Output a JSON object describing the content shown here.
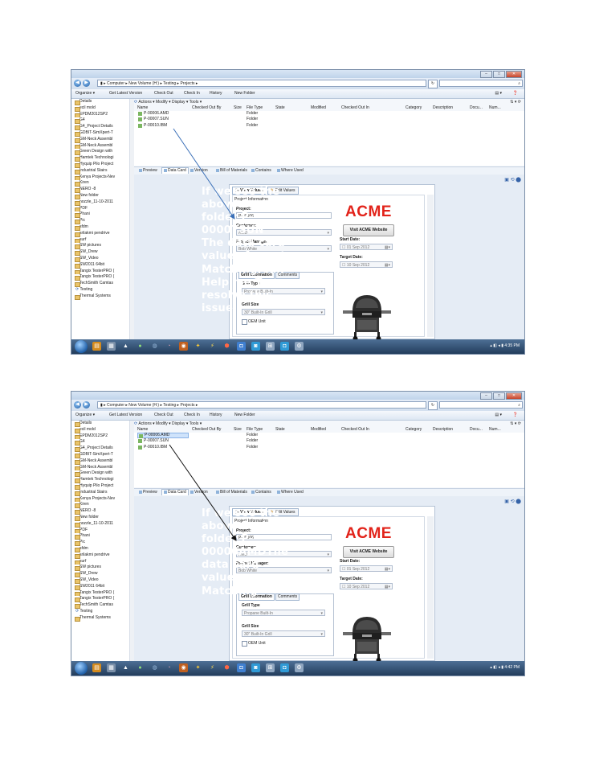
{
  "screenshots": [
    {
      "window": {
        "address": [
          "Computer",
          "New Volume (H:)",
          "Testing",
          "Projects"
        ],
        "menu": [
          "Organize ▾",
          "Get Latest Version",
          "Check Out",
          "Check In",
          "History",
          "New Folder"
        ]
      },
      "tree_items": [
        "Details",
        "ecil mold",
        "EPDM2012SP2",
        "G4",
        "G4_Project Details",
        "GDBIT-SimXpert-T",
        "GM-Neck Assembl",
        "GM-Neck Assembl",
        "Green Design with",
        "Hamtek Technologi",
        "Hyquip Pilo Project",
        "Industrial Stairs",
        "Kenya Projects-Nev",
        "Kiren",
        "NERO -8",
        "New folder",
        "nozzle_11-10-2011",
        "PDF",
        "Phani",
        "Pic",
        "sfdm",
        "srilakmi pendrive",
        "surf",
        "SW pictures",
        "SW_Drew",
        "SW_Video",
        "SW2011 64bit",
        "Tangix TesterPRO (",
        "Tangix TesterPRO (",
        "TechSmith Camtas"
      ],
      "vault_items": [
        "Testing",
        "Thermal Systems"
      ],
      "toolbar": {
        "actions": "Actions ▾",
        "modify": "Modify ▾",
        "display": "Display ▾",
        "tools": "Tools ▾"
      },
      "columns": [
        "Name",
        "Checked Out By",
        "Size",
        "File Type",
        "State",
        "Modified",
        "Checked Out In",
        "Category",
        "Description",
        "Docu...",
        "Num..."
      ],
      "files": [
        {
          "name": "P-00006.AMD",
          "type": "Folder"
        },
        {
          "name": "P-00007.SUN",
          "type": "Folder"
        },
        {
          "name": "P-00010.IBM",
          "type": "Folder"
        }
      ],
      "selected_file": -1,
      "tabs": [
        "Preview",
        "Data Card",
        "Version",
        "Bill of Materials",
        "Contains",
        "Where Used"
      ],
      "card": {
        "view_tab": "View Values",
        "edit_tab": "Edit Values",
        "section": "Project Information",
        "project_label": "Project:",
        "project_value": "P-00006",
        "customer_label": "Customer:",
        "customer_value": "AMD",
        "manager_label": "Project Manager:",
        "manager_value": "Bob White",
        "logo": "ACME",
        "visit_button": "Visit ACME Website",
        "start_label": "Start Date:",
        "start_value": "01 Sep 2012",
        "target_label": "Target Date:",
        "target_value": "10 Sep 2012",
        "grill_tab": "Grill Information",
        "comments_tab": "Comments",
        "grill_type_label": "Grill Type",
        "grill_type_value": "Propane Built-In",
        "grill_size_label": "Grill Size",
        "grill_size_value": "30\" Built-In Grill",
        "oem_label": "OEM Unit"
      },
      "note": "If we see the above Project folder P-00007SUN The data card values for not Matching.Can Help me To resolve this issue.",
      "clock": "4:35 PM"
    },
    {
      "window": {
        "address": [
          "Computer",
          "New Volume (H:)",
          "Testing",
          "Projects"
        ],
        "menu": [
          "Organize ▾",
          "Get Latest Version",
          "Check Out",
          "Check In",
          "History",
          "New Folder"
        ]
      },
      "tree_items": [
        "Details",
        "ecil mold",
        "EPDM2012SP2",
        "G4",
        "G4_Project Details",
        "GDBIT-SimXpert-T",
        "GM-Neck Assembl",
        "GM-Neck Assembl",
        "Green Design with",
        "Hamtek Technologi",
        "Hyquip Pilo Project",
        "Industrial Stairs",
        "Kenya Projects-Nev",
        "Kiren",
        "NERO -8",
        "New folder",
        "nozzle_11-10-2011",
        "PDF",
        "Phani",
        "Pic",
        "sfdm",
        "srilakmi pendrive",
        "surf",
        "SW pictures",
        "SW_Drew",
        "SW_Video",
        "SW2011 64bit",
        "Tangix TesterPRO (",
        "Tangix TesterPRO (",
        "TechSmith Camtas"
      ],
      "vault_items": [
        "Testing",
        "Thermal Systems"
      ],
      "toolbar": {
        "actions": "Actions ▾",
        "modify": "Modify ▾",
        "display": "Display ▾",
        "tools": "Tools ▾"
      },
      "columns": [
        "Name",
        "Checked Out By",
        "Size",
        "File Type",
        "State",
        "Modified",
        "Checked Out In",
        "Category",
        "Description",
        "Docu...",
        "Num..."
      ],
      "files": [
        {
          "name": "P-00006.AMD",
          "type": "Folder"
        },
        {
          "name": "P-00007.SUN",
          "type": "Folder"
        },
        {
          "name": "P-00010.IBM",
          "type": "Folder"
        }
      ],
      "selected_file": 0,
      "tabs": [
        "Preview",
        "Data Card",
        "Version",
        "Bill of Materials",
        "Contains",
        "Where Used"
      ],
      "card": {
        "view_tab": "View Values",
        "edit_tab": "Edit Values",
        "section": "Project Information",
        "project_label": "Project:",
        "project_value": "P-00006",
        "customer_label": "Customer:",
        "customer_value": "AMD",
        "manager_label": "Project Manager:",
        "manager_value": "Bob White",
        "logo": "ACME",
        "visit_button": "Visit ACME Website",
        "start_label": "Start Date:",
        "start_value": "01 Sep 2012",
        "target_label": "Target Date:",
        "target_value": "10 Sep 2012",
        "grill_tab": "Grill Information",
        "comments_tab": "Comments",
        "grill_type_label": "Grill Type",
        "grill_type_value": "Propane Built-In",
        "grill_size_label": "Grill Size",
        "grill_size_value": "30\" Built-In Grill",
        "oem_label": "OEM Unit"
      },
      "note": "If we see the above Project folder P-00006AMDThe data card values are Matching",
      "clock": "4:42 PM"
    }
  ],
  "colors": {
    "note_text": "#ffffff",
    "logo": "#e2231a",
    "arrow_1": "#3a6fb7",
    "arrow_2": "#111111"
  }
}
